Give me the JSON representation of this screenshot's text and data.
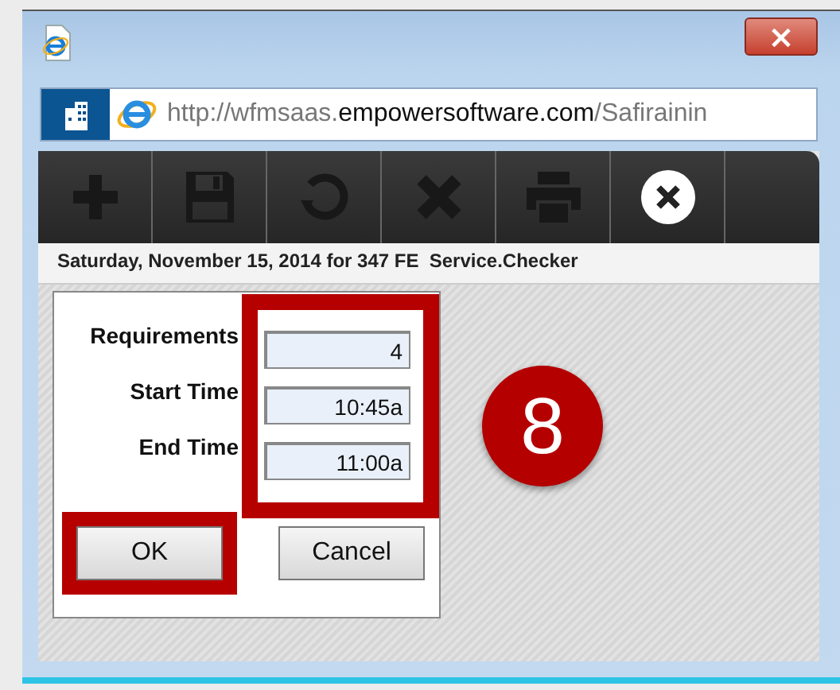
{
  "window": {
    "close_label": "×"
  },
  "address_bar": {
    "prefix": "http://wfmsaas.",
    "domain": "empowersoftware.com",
    "path": "/Safirainin"
  },
  "toolbar": [
    {
      "kind": "add",
      "disabled": true
    },
    {
      "kind": "save",
      "disabled": true
    },
    {
      "kind": "refresh",
      "disabled": true
    },
    {
      "kind": "delete",
      "disabled": true
    },
    {
      "kind": "print",
      "disabled": true
    },
    {
      "kind": "close",
      "disabled": false
    }
  ],
  "header": "Saturday, November 15, 2014 for 347 FE  Service.Checker",
  "fields": [
    {
      "label": "Requirements",
      "value": "4"
    },
    {
      "label": "Start Time",
      "value": "10:45a"
    },
    {
      "label": "End Time",
      "value": "11:00a"
    }
  ],
  "fields_highlighted": true,
  "buttons": [
    {
      "label": "OK",
      "highlighted": true
    },
    {
      "label": "Cancel",
      "highlighted": false
    }
  ],
  "step_badge": "8"
}
